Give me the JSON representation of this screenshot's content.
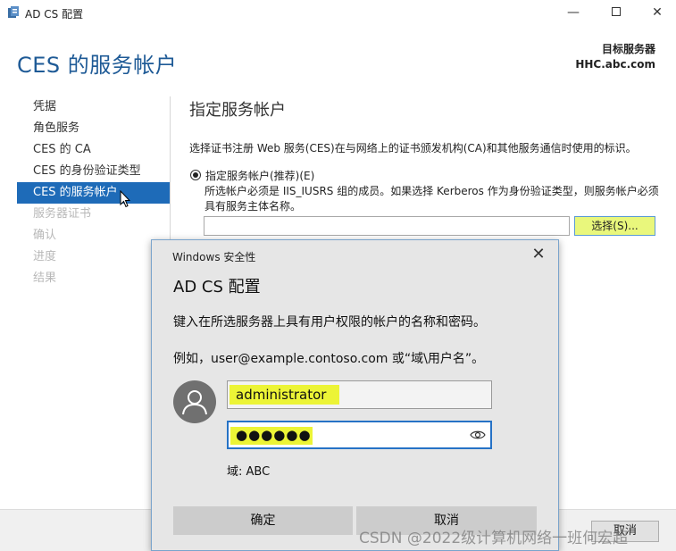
{
  "window": {
    "title": "AD CS 配置",
    "minimize": "—",
    "close": "✕"
  },
  "page": {
    "title": "CES 的服务帐户",
    "target_label": "目标服务器",
    "target_value": "HHC.abc.com"
  },
  "nav": {
    "items": [
      {
        "label": "凭据",
        "state": "normal"
      },
      {
        "label": "角色服务",
        "state": "normal"
      },
      {
        "label": "CES 的 CA",
        "state": "normal"
      },
      {
        "label": "CES 的身份验证类型",
        "state": "normal"
      },
      {
        "label": "CES 的服务帐户",
        "state": "active"
      },
      {
        "label": "服务器证书",
        "state": "disabled"
      },
      {
        "label": "确认",
        "state": "disabled"
      },
      {
        "label": "进度",
        "state": "disabled"
      },
      {
        "label": "结果",
        "state": "disabled"
      }
    ]
  },
  "content": {
    "section_title": "指定服务帐户",
    "description": "选择证书注册 Web 服务(CES)在与网络上的证书颁发机构(CA)和其他服务通信时使用的标识。",
    "radio_label": "指定服务帐户(推荐)(E)",
    "radio_desc": "所选帐户必须是 IIS_IUSRS 组的成员。如果选择 Kerberos 作为身份验证类型，则服务帐户必须具有服务主体名称。",
    "account_value": "",
    "select_button": "选择(S)..."
  },
  "footer": {
    "cancel": "取消"
  },
  "dialog": {
    "title": "Windows 安全性",
    "close": "✕",
    "heading": "AD CS 配置",
    "text1": "键入在所选服务器上具有用户权限的帐户的名称和密码。",
    "text2": "例如，user@example.contoso.com 或“域\\用户名”。",
    "username": "administrator",
    "password": "●●●●●●",
    "domain": "域: ABC",
    "ok": "确定",
    "cancel": "取消"
  },
  "watermark": "CSDN @2022级计算机网络一班何宏超",
  "colors": {
    "title_blue": "#1e5a96",
    "nav_active": "#1e6bb8",
    "highlight_yellow": "#ecf436",
    "focus_blue": "#2672c6"
  }
}
